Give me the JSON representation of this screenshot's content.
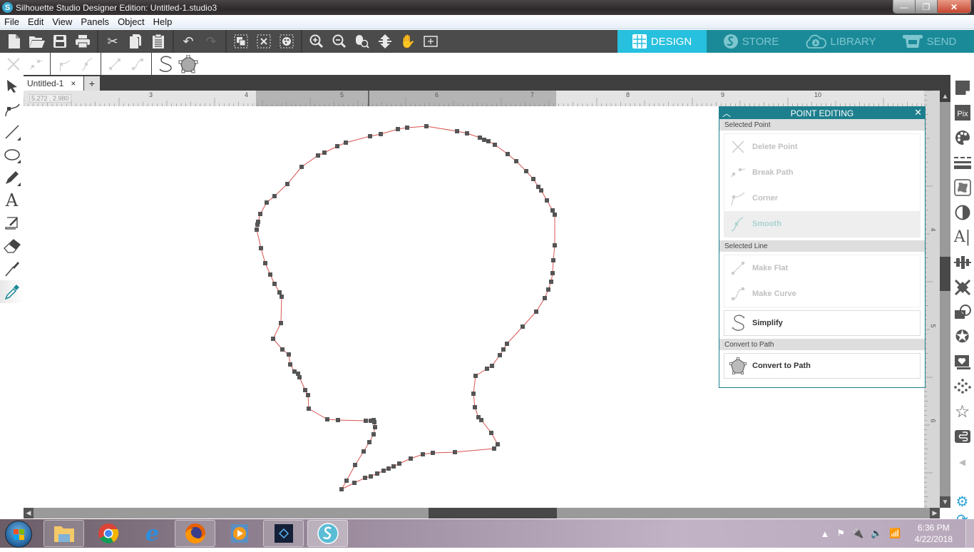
{
  "window": {
    "title": "Silhouette Studio Designer Edition: Untitled-1.studio3",
    "controls": {
      "minimize": "—",
      "maximize": "❐",
      "close": "✕"
    }
  },
  "menu": [
    "File",
    "Edit",
    "View",
    "Panels",
    "Object",
    "Help"
  ],
  "toolbar": {
    "groups": [
      [
        "new-document-icon",
        "open-folder-icon",
        "save-icon",
        "print-icon"
      ],
      [
        "cut-icon",
        "copy-icon",
        "paste-icon"
      ],
      [
        "undo-icon",
        "redo-icon"
      ],
      [
        "group-icon",
        "ungroup-icon",
        "fill-pattern-icon"
      ],
      [
        "zoom-in-icon",
        "zoom-out-icon",
        "zoom-selection-icon",
        "fit-to-page-icon",
        "pan-hand-icon",
        "zoom-add-icon"
      ]
    ]
  },
  "nav_tabs": [
    {
      "label": "DESIGN",
      "icon": "grid-icon",
      "active": true
    },
    {
      "label": "STORE",
      "icon": "silhouette-s-icon",
      "active": false
    },
    {
      "label": "LIBRARY",
      "icon": "cloud-download-icon",
      "active": false
    },
    {
      "label": "SEND",
      "icon": "cutter-icon",
      "active": false
    }
  ],
  "point_toolbar": [
    "delete-point",
    "break-path",
    "corner",
    "smooth",
    "make-flat",
    "make-curve",
    "simplify",
    "convert-to-path"
  ],
  "document_tab": {
    "label": "Untitled-1",
    "close": "×",
    "add": "+"
  },
  "ruler": {
    "coordinate_readout": "5.272 , 2.980",
    "h_labels": [
      "3",
      "4",
      "5",
      "6",
      "7",
      "8",
      "9",
      "10"
    ],
    "v_labels": [
      "4",
      "5",
      "6"
    ]
  },
  "left_tools": [
    "select-arrow",
    "point-edit",
    "line",
    "ellipse",
    "pencil",
    "text",
    "sketch",
    "eraser",
    "knife",
    "eyedropper"
  ],
  "right_tools": [
    "page-setup",
    "pixscan",
    "fill-color",
    "line-style",
    "trace",
    "fill-gradient",
    "text-style",
    "align",
    "replicate",
    "modify",
    "offset",
    "knife-panel",
    "rhinestone",
    "store-favorites",
    "library-panel",
    "collapse-arrow",
    "settings",
    "sync"
  ],
  "point_editing_panel": {
    "title": "POINT EDITING",
    "sections": {
      "selected_point": "Selected Point",
      "selected_line": "Selected Line",
      "convert": "Convert to Path"
    },
    "point_actions": [
      {
        "label": "Delete Point",
        "enabled": false
      },
      {
        "label": "Break Path",
        "enabled": false
      },
      {
        "label": "Corner",
        "enabled": false
      },
      {
        "label": "Smooth",
        "enabled": false,
        "highlighted": true
      }
    ],
    "line_actions": [
      {
        "label": "Make Flat",
        "enabled": false
      },
      {
        "label": "Make Curve",
        "enabled": false
      }
    ],
    "simplify": "Simplify",
    "convert_to_path": "Convert to Path"
  },
  "shape": {
    "name": "head-silhouette-outline",
    "stroke_color": "#d9534f",
    "node_color": "#555555"
  },
  "taskbar": {
    "apps": [
      "windows-explorer",
      "chrome",
      "internet-explorer",
      "firefox",
      "media-player",
      "photoshop-elements",
      "silhouette-studio"
    ],
    "time": "6:36 PM",
    "date": "4/22/2018"
  },
  "colors": {
    "accent": "#27c0de",
    "nav_bg": "#1b8a98",
    "panel_header": "#1d7f8d",
    "toolbar_bg": "#4b4b4b"
  }
}
